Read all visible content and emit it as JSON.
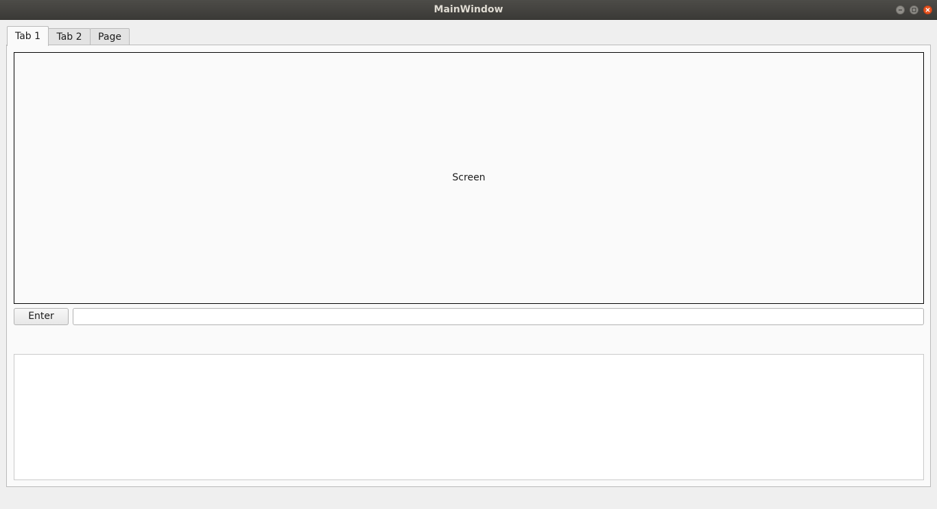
{
  "window": {
    "title": "MainWindow"
  },
  "titlebar_buttons": {
    "minimize_icon": "minimize-icon",
    "maximize_icon": "maximize-icon",
    "close_icon": "close-icon",
    "close_color": "#e9541f"
  },
  "tabs": [
    {
      "label": "Tab 1",
      "active": true
    },
    {
      "label": "Tab 2",
      "active": false
    },
    {
      "label": "Page",
      "active": false
    }
  ],
  "main": {
    "screen_label": "Screen",
    "enter_label": "Enter",
    "input_value": "",
    "input_placeholder": "",
    "output_text": ""
  }
}
